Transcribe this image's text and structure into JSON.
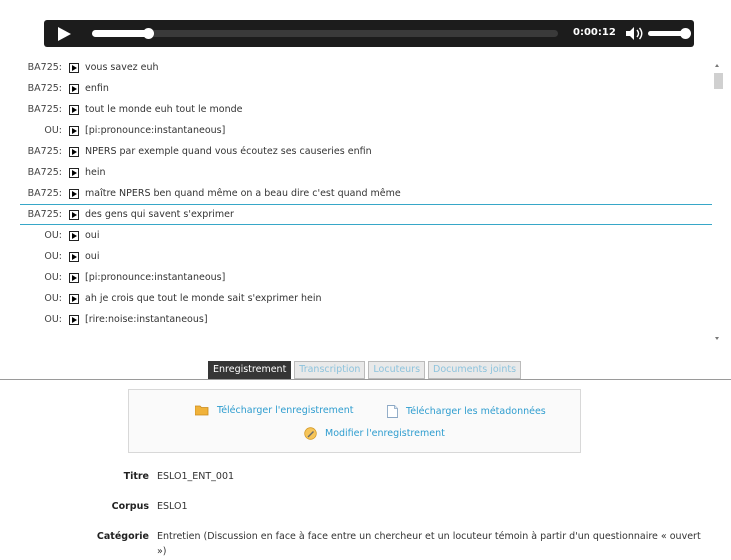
{
  "player": {
    "time": "0:00:12",
    "progress": 0.12,
    "volume": 0.85,
    "icons": [
      "play-icon",
      "volume-icon"
    ]
  },
  "transcript": {
    "rows": [
      {
        "speaker": "BA725:",
        "text": "vous savez euh"
      },
      {
        "speaker": "BA725:",
        "text": "enfin"
      },
      {
        "speaker": "BA725:",
        "text": "tout le monde euh tout le monde"
      },
      {
        "speaker": "OU:",
        "text": "[pi:pronounce:instantaneous]"
      },
      {
        "speaker": "BA725:",
        "text": "NPERS par exemple quand vous écoutez ses causeries enfin"
      },
      {
        "speaker": "BA725:",
        "text": "hein"
      },
      {
        "speaker": "BA725:",
        "text": "maître NPERS ben quand même on a beau dire c'est quand même"
      },
      {
        "speaker": "BA725:",
        "text": "des gens qui savent s'exprimer",
        "active": true
      },
      {
        "speaker": "OU:",
        "text": "oui"
      },
      {
        "speaker": "OU:",
        "text": "oui"
      },
      {
        "speaker": "OU:",
        "text": "[pi:pronounce:instantaneous]"
      },
      {
        "speaker": "OU:",
        "text": "ah je crois que tout le monde sait s'exprimer hein"
      },
      {
        "speaker": "OU:",
        "text": "[rire:noise:instantaneous]"
      }
    ]
  },
  "tabs": [
    "Enregistrement",
    "Transcription",
    "Locuteurs",
    "Documents joints"
  ],
  "actions": {
    "download_recording": "Télécharger l'enregistrement",
    "download_metadata": "Télécharger les métadonnées",
    "edit_recording": "Modifier l'enregistrement",
    "icons": [
      "folder-icon",
      "document-icon",
      "edit-icon"
    ]
  },
  "metadata": {
    "title_label": "Titre",
    "title_value": "ESLO1_ENT_001",
    "corpus_label": "Corpus",
    "corpus_value": "ESLO1",
    "category_label": "Catégorie",
    "category_value_line1": "Entretien (Discussion en face à face entre un chercheur et un locuteur témoin à partir d'un questionnaire « ouvert",
    "category_value_line2": "»)"
  },
  "colors": {
    "accent": "#2f9dcf",
    "active_row_border": "#37a7c8",
    "player_bg": "#1c1c1c",
    "tab_active_bg": "#363636"
  }
}
